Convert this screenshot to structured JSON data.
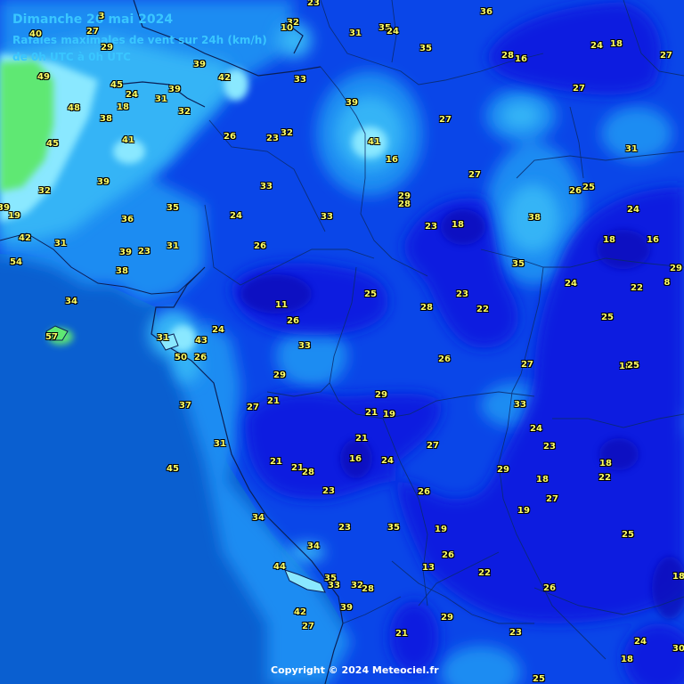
{
  "header": {
    "title": "Dimanche 26 mai 2024",
    "subtitle": "Rafales maximales de vent sur 24h (km/h)",
    "period": "de 0h UTC à 0h UTC"
  },
  "copyright": "Copyright © 2024 Meteociel.fr",
  "colors": {
    "ocean": "#0a5fd0",
    "band_20_30": "#0a46e8",
    "band_10_20": "#0a1ee0",
    "band_30_35": "#1f8cf2",
    "band_35_40": "#36b4f6",
    "band_40_45": "#8ae8ff",
    "band_45_plus": "#5fe873",
    "labels": "#ffff66"
  },
  "values": [
    "3",
    "23",
    "40",
    "32",
    "36",
    "10",
    "27",
    "35",
    "24",
    "31",
    "35",
    "24",
    "16",
    "18",
    "27",
    "49",
    "45",
    "29",
    "39",
    "42",
    "33",
    "28",
    "16",
    "24",
    "31",
    "27",
    "48",
    "18",
    "39",
    "38",
    "32",
    "41",
    "39",
    "41",
    "26",
    "23",
    "32",
    "27",
    "16",
    "45",
    "31",
    "27",
    "32",
    "39",
    "33",
    "29",
    "26",
    "25",
    "24",
    "19",
    "36",
    "35",
    "28",
    "24",
    "39",
    "33",
    "23",
    "18",
    "18",
    "16",
    "42",
    "31",
    "38",
    "29",
    "26",
    "38",
    "54",
    "39",
    "23",
    "31",
    "35",
    "22",
    "8",
    "38",
    "25",
    "24",
    "34",
    "11",
    "28",
    "23",
    "22",
    "57",
    "31",
    "43",
    "24",
    "25",
    "26",
    "33",
    "50",
    "26",
    "29",
    "27",
    "26",
    "18",
    "25",
    "29",
    "33",
    "21",
    "21",
    "19",
    "21",
    "37",
    "27",
    "24",
    "31",
    "27",
    "23",
    "16",
    "24",
    "21",
    "21",
    "28",
    "29",
    "45",
    "18",
    "22",
    "23",
    "26",
    "18",
    "34",
    "27",
    "34",
    "19",
    "23",
    "19",
    "25",
    "13",
    "44",
    "35",
    "26",
    "22",
    "35",
    "26",
    "33",
    "32",
    "28",
    "42",
    "39",
    "27",
    "29",
    "21",
    "23",
    "24",
    "30",
    "18",
    "18",
    "25"
  ]
}
